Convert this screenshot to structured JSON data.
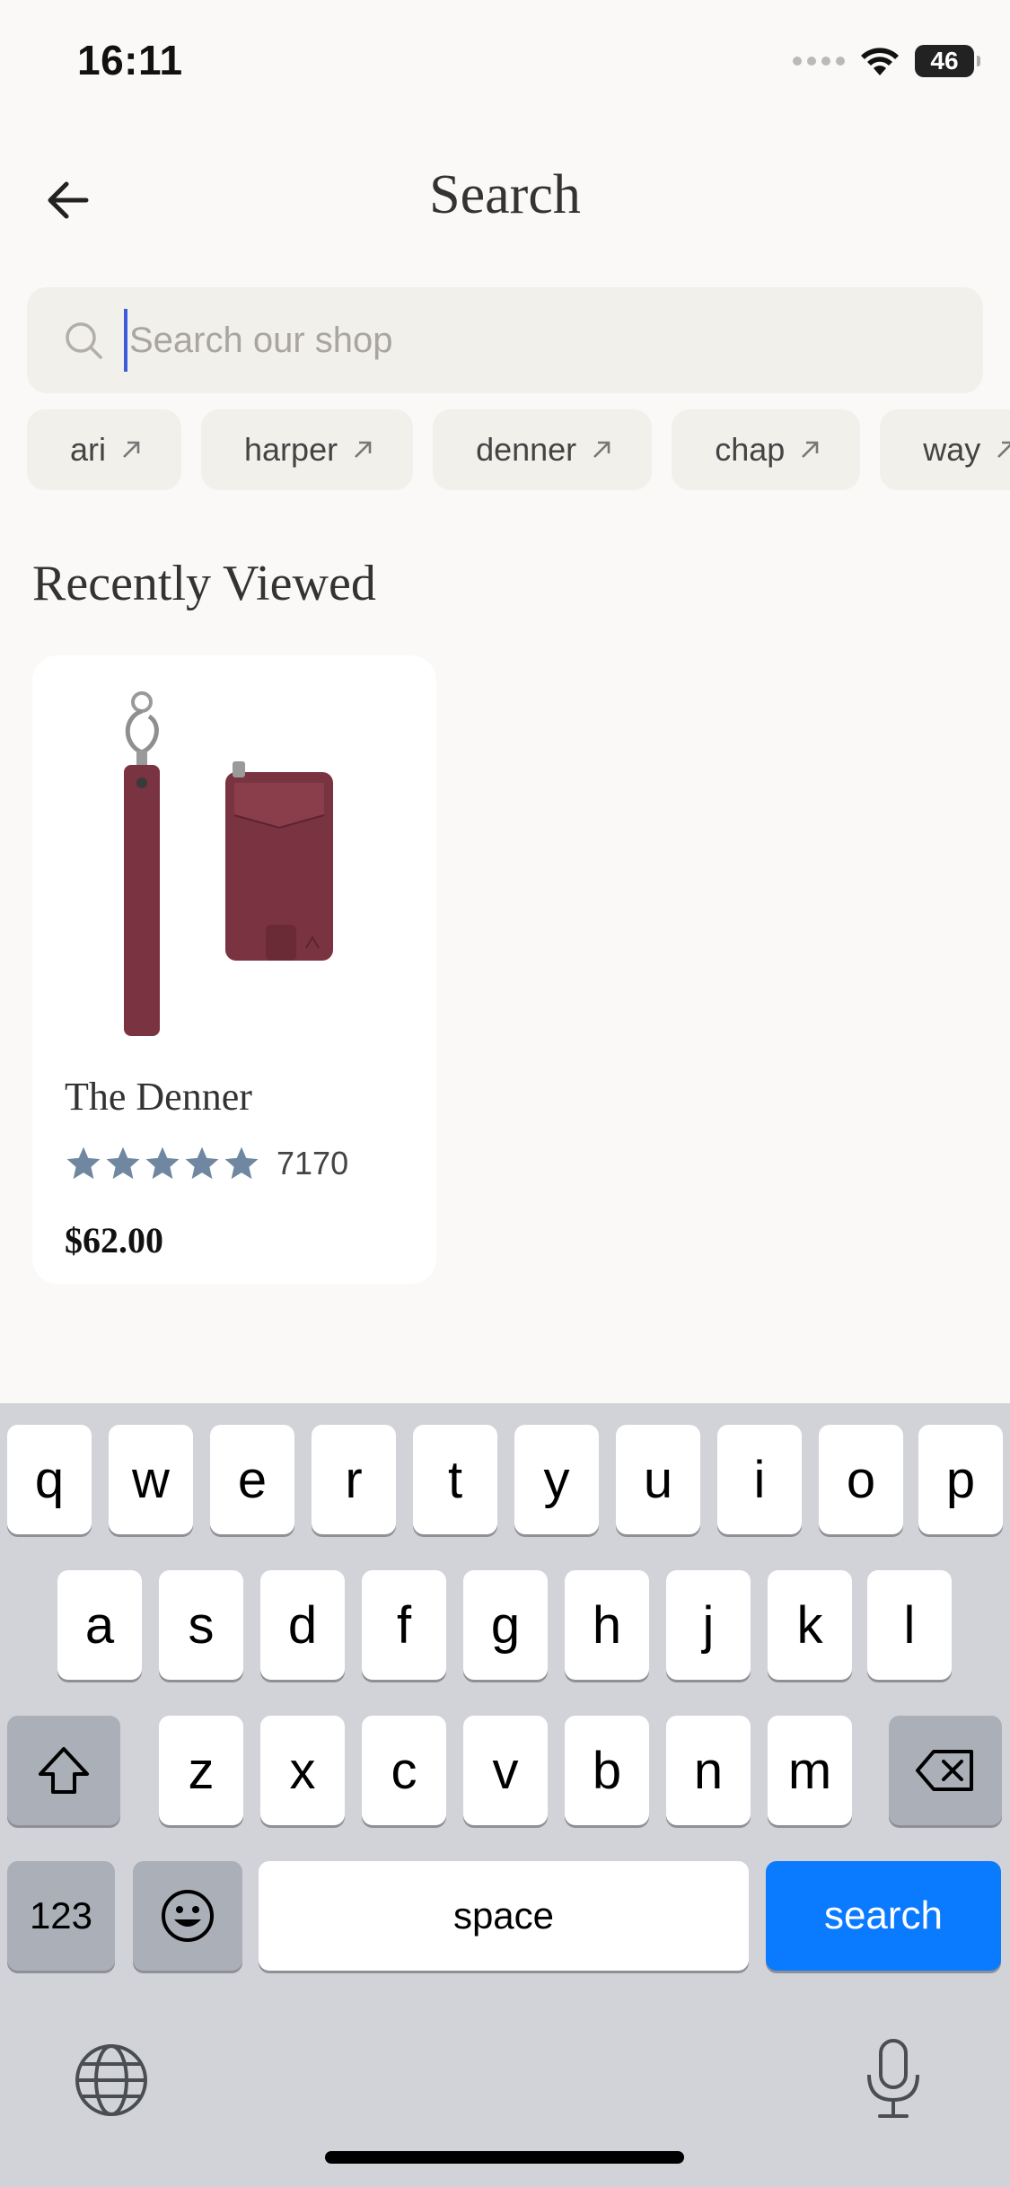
{
  "status_bar": {
    "time": "16:11",
    "battery": "46"
  },
  "header": {
    "title": "Search"
  },
  "search": {
    "placeholder": "Search our shop",
    "value": ""
  },
  "suggestions": [
    {
      "label": "ari"
    },
    {
      "label": "harper"
    },
    {
      "label": "denner"
    },
    {
      "label": "chap"
    },
    {
      "label": "way"
    }
  ],
  "recently_viewed": {
    "title": "Recently Viewed",
    "items": [
      {
        "name": "The Denner",
        "rating": 5,
        "review_count": "7170",
        "price": "$62.00",
        "product_color": "#7a3340"
      }
    ]
  },
  "keyboard": {
    "row1": [
      "q",
      "w",
      "e",
      "r",
      "t",
      "y",
      "u",
      "i",
      "o",
      "p"
    ],
    "row2": [
      "a",
      "s",
      "d",
      "f",
      "g",
      "h",
      "j",
      "k",
      "l"
    ],
    "row3": [
      "z",
      "x",
      "c",
      "v",
      "b",
      "n",
      "m"
    ],
    "numbers_label": "123",
    "space_label": "space",
    "action_label": "search",
    "shift_icon": "shift-icon",
    "delete_icon": "delete-icon",
    "emoji_icon": "emoji-icon",
    "globe_icon": "globe-icon",
    "mic_icon": "microphone-icon"
  },
  "colors": {
    "background": "#faf9f7",
    "chip": "#f2f0eb",
    "star": "#6f87a0",
    "keyboard_action": "#0a7aff"
  }
}
